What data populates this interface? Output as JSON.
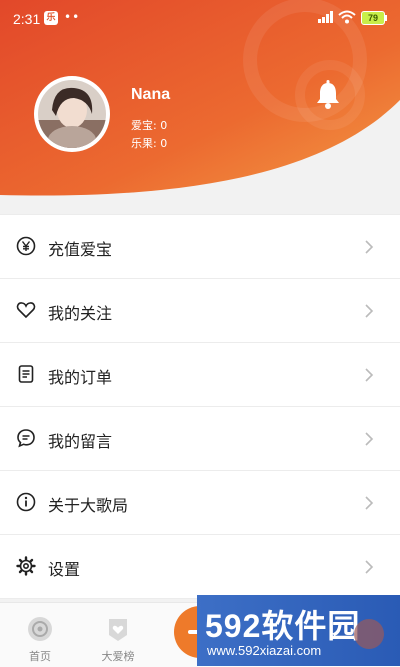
{
  "status_bar": {
    "time": "2:31",
    "app_icon_text": "乐",
    "dots": "••",
    "battery": "79"
  },
  "profile": {
    "name": "Nana",
    "love_treasure": "爱宝: 0",
    "fun_fruit": "乐果: 0"
  },
  "menu": {
    "items": [
      {
        "label": "充值爱宝",
        "icon": "yen-circle-icon"
      },
      {
        "label": "我的关注",
        "icon": "heart-icon"
      },
      {
        "label": "我的订单",
        "icon": "document-icon"
      },
      {
        "label": "我的留言",
        "icon": "chat-bubble-icon"
      },
      {
        "label": "关于大歌局",
        "icon": "info-circle-icon"
      },
      {
        "label": "设置",
        "icon": "gear-icon"
      }
    ]
  },
  "tab_bar": {
    "tabs": [
      {
        "label": "首页",
        "icon": "home-disc-icon"
      },
      {
        "label": "大爱榜",
        "icon": "heart-badge-icon"
      }
    ],
    "center_button_icon": "plus-icon"
  },
  "watermark": {
    "title": "592软件园",
    "url": "www.592xiazai.com"
  },
  "colors": {
    "header_top": "#e8542a",
    "header_bottom": "#f08a3a",
    "accent": "#ee7a2a"
  }
}
